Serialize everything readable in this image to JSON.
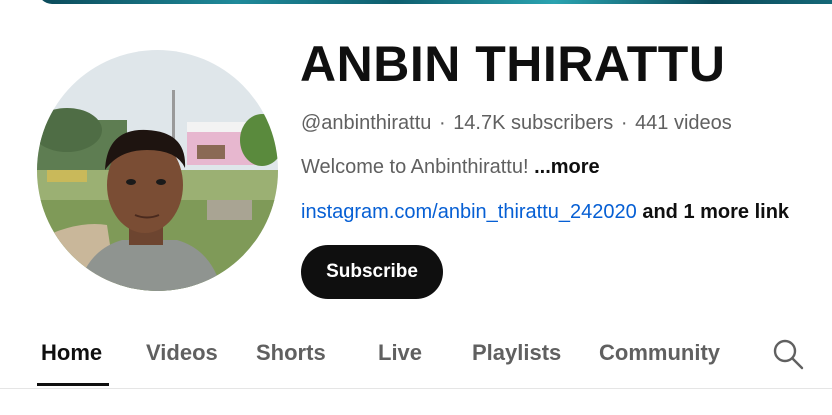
{
  "channel": {
    "name": "ANBIN THIRATTU",
    "handle": "@anbinthirattu",
    "separator": "·",
    "subscribers": "14.7K subscribers",
    "videos": "441 videos",
    "description": "Welcome to Anbinthirattu!",
    "description_more": "...more",
    "link_text": "instagram.com/anbin_thirattu_242020",
    "more_links": "and 1 more link"
  },
  "actions": {
    "subscribe_label": "Subscribe"
  },
  "tabs": [
    {
      "label": "Home",
      "active": true
    },
    {
      "label": "Videos",
      "active": false
    },
    {
      "label": "Shorts",
      "active": false
    },
    {
      "label": "Live",
      "active": false
    },
    {
      "label": "Playlists",
      "active": false
    },
    {
      "label": "Community",
      "active": false
    }
  ],
  "icons": {
    "search": "search-icon",
    "avatar": "avatar"
  },
  "colors": {
    "text_primary": "#0f0f0f",
    "text_secondary": "#606060",
    "link": "#065fd4",
    "subscribe_bg": "#0f0f0f",
    "banner_accent": "#1f8a9a"
  }
}
